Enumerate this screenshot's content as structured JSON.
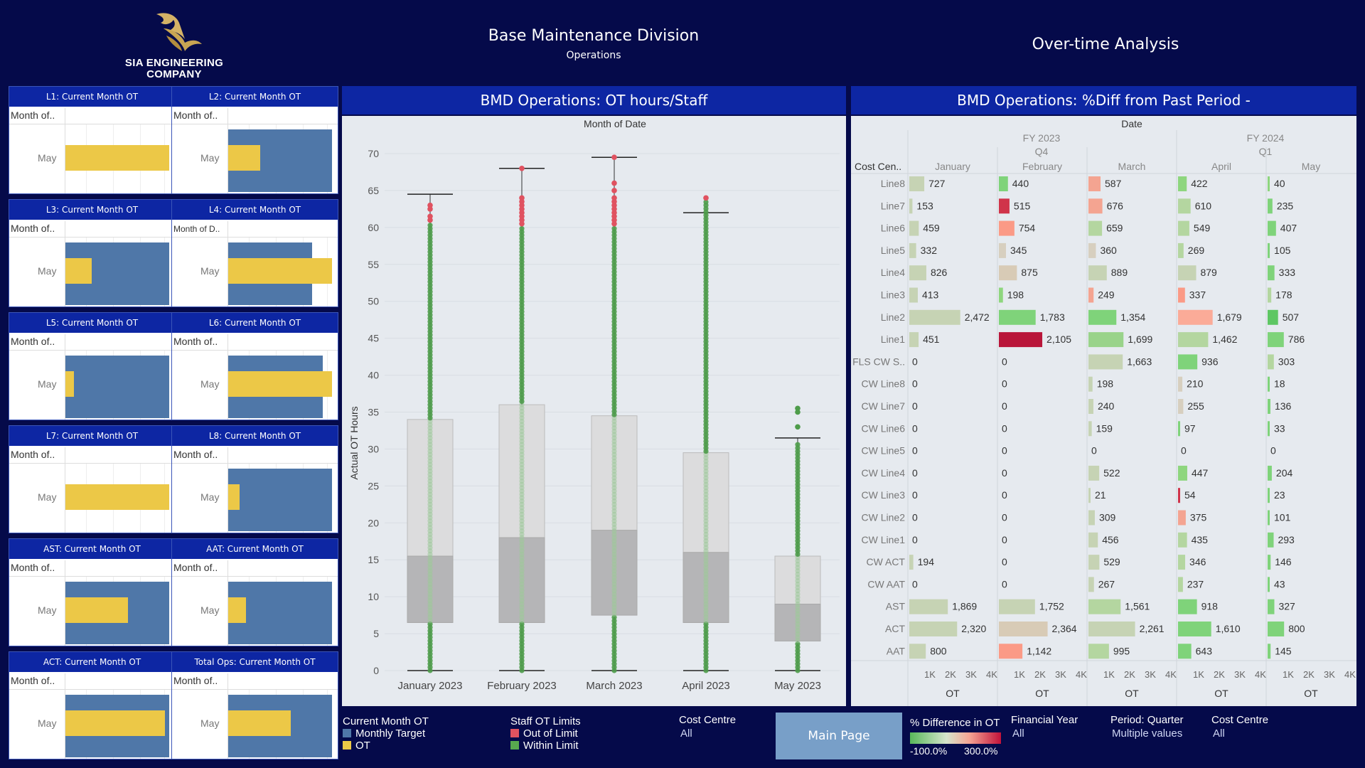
{
  "header": {
    "logo_line1": "SIA ENGINEERING",
    "logo_line2": "COMPANY",
    "title": "Base Maintenance Division",
    "subtitle": "Operations",
    "right_title": "Over-time Analysis"
  },
  "small_multiples": [
    {
      "title": "L1: Current Month OT",
      "col_header": "Month of..",
      "row": "May",
      "target": 0,
      "ot": 1.0
    },
    {
      "title": "L2: Current Month OT",
      "col_header": "Month of..",
      "row": "May",
      "target": 1.0,
      "ot": 0.31
    },
    {
      "title": "L3: Current Month OT",
      "col_header": "Month of..",
      "row": "May",
      "target": 1.0,
      "ot": 0.25
    },
    {
      "title": "L4: Current Month OT",
      "col_header": "Month of D..",
      "row": "May",
      "target": 0.81,
      "ot": 1.0
    },
    {
      "title": "L5: Current Month OT",
      "col_header": "Month of..",
      "row": "May",
      "target": 1.0,
      "ot": 0.08
    },
    {
      "title": "L6: Current Month OT",
      "col_header": "Month of..",
      "row": "May",
      "target": 0.91,
      "ot": 1.0
    },
    {
      "title": "L7: Current Month OT",
      "col_header": "Month of..",
      "row": "May",
      "target": 0,
      "ot": 1.0
    },
    {
      "title": "L8: Current Month OT",
      "col_header": "Month of..",
      "row": "May",
      "target": 1.0,
      "ot": 0.11
    },
    {
      "title": "AST: Current Month OT",
      "col_header": "Month of..",
      "row": "May",
      "target": 1.0,
      "ot": 0.6
    },
    {
      "title": "AAT: Current Month OT",
      "col_header": "Month of..",
      "row": "May",
      "target": 1.0,
      "ot": 0.17
    },
    {
      "title": "ACT: Current Month OT",
      "col_header": "Month of..",
      "row": "May",
      "target": 1.0,
      "ot": 0.96
    },
    {
      "title": "Total Ops: Current Month OT",
      "col_header": "Month of..",
      "row": "May",
      "target": 1.0,
      "ot": 0.6
    }
  ],
  "boxplot": {
    "panel_title": "BMD Operations: OT hours/Staff",
    "column_header": "Month of Date",
    "ylabel": "Actual OT Hours",
    "yticks": [
      "70",
      "65",
      "60",
      "55",
      "50",
      "45",
      "40",
      "35",
      "30",
      "25",
      "20",
      "15",
      "10",
      "5",
      "0"
    ]
  },
  "chart_data": {
    "type": "box",
    "categories": [
      "January 2023",
      "February 2023",
      "March 2023",
      "April 2023",
      "May 2023"
    ],
    "ylabel": "Actual OT Hours",
    "ylim": [
      0,
      70
    ],
    "series": [
      {
        "category": "January 2023",
        "min": 0,
        "q1": 6.5,
        "median": 15.5,
        "q3": 34,
        "whisker_high": 64.5,
        "outliers": [
          61,
          61.5,
          62.5,
          63
        ]
      },
      {
        "category": "February 2023",
        "min": 0,
        "q1": 6.5,
        "median": 18,
        "q3": 36,
        "whisker_high": 68,
        "outliers": [
          60.5,
          61,
          61.5,
          62,
          62.5,
          63,
          63.5,
          64,
          68
        ]
      },
      {
        "category": "March 2023",
        "min": 0,
        "q1": 7.5,
        "median": 19,
        "q3": 34.5,
        "whisker_high": 69.5,
        "outliers": [
          60.5,
          61,
          61.5,
          62,
          62.5,
          63,
          63.5,
          64,
          65,
          66,
          69.5
        ]
      },
      {
        "category": "April 2023",
        "min": 0,
        "q1": 6.5,
        "median": 16,
        "q3": 29.5,
        "whisker_high": 62,
        "outliers": [
          64
        ]
      },
      {
        "category": "May 2023",
        "min": 0,
        "q1": 4,
        "median": 9,
        "q3": 15.5,
        "whisker_high": 31.5,
        "outliers": [
          33,
          35,
          35.5
        ]
      }
    ]
  },
  "heat": {
    "panel_title": "BMD Operations: %Diff from Past Period -",
    "date_header": "Date",
    "row_header": "Cost Cen..",
    "fy2023": "FY 2023",
    "fy2023_q": "Q4",
    "fy2024": "FY 2024",
    "fy2024_q": "Q1",
    "months": [
      "January",
      "February",
      "March",
      "April",
      "May"
    ],
    "axis_ticks": [
      "1K",
      "2K",
      "3K",
      "4K"
    ],
    "axis_title": "OT",
    "rows": [
      {
        "name": "Line8",
        "vals": [
          727,
          440,
          587,
          422,
          40
        ],
        "labels": [
          "727",
          "440",
          "587",
          "422",
          "40"
        ],
        "colors": [
          "#c6d3b4",
          "#7fd37a",
          "#f4a491",
          "#8ed67e",
          "#8ed67e"
        ]
      },
      {
        "name": "Line7",
        "vals": [
          153,
          515,
          676,
          610,
          235
        ],
        "labels": [
          "153",
          "515",
          "676",
          "610",
          "235"
        ],
        "colors": [
          "#c6d3b4",
          "#d0344a",
          "#f4a491",
          "#b4d6a0",
          "#7fd37a"
        ]
      },
      {
        "name": "Line6",
        "vals": [
          459,
          754,
          659,
          549,
          407
        ],
        "labels": [
          "459",
          "754",
          "659",
          "549",
          "407"
        ],
        "colors": [
          "#c6d3b4",
          "#fb9a86",
          "#b4d6a0",
          "#b4d6a0",
          "#7fd37a"
        ]
      },
      {
        "name": "Line5",
        "vals": [
          332,
          345,
          360,
          269,
          105
        ],
        "labels": [
          "332",
          "345",
          "360",
          "269",
          "105"
        ],
        "colors": [
          "#c6d3b4",
          "#d7cfbf",
          "#d7cfbf",
          "#b4d6a0",
          "#7fd37a"
        ]
      },
      {
        "name": "Line4",
        "vals": [
          826,
          875,
          889,
          879,
          333
        ],
        "labels": [
          "826",
          "875",
          "889",
          "879",
          "333"
        ],
        "colors": [
          "#c6d3b4",
          "#d8cbb6",
          "#c6d3b4",
          "#c6d3b4",
          "#7fd37a"
        ]
      },
      {
        "name": "Line3",
        "vals": [
          413,
          198,
          249,
          337,
          178
        ],
        "labels": [
          "413",
          "198",
          "249",
          "337",
          "178"
        ],
        "colors": [
          "#c6d3b4",
          "#8ed67e",
          "#f4a491",
          "#fb9a86",
          "#b4d6a0"
        ]
      },
      {
        "name": "Line2",
        "vals": [
          2472,
          1783,
          1354,
          1679,
          507
        ],
        "labels": [
          "2,472",
          "1,783",
          "1,354",
          "1,679",
          "507"
        ],
        "colors": [
          "#c6d3b4",
          "#7fd37a",
          "#7fd37a",
          "#fbab98",
          "#5ec763"
        ]
      },
      {
        "name": "Line1",
        "vals": [
          451,
          2105,
          1699,
          1462,
          786
        ],
        "labels": [
          "451",
          "2,105",
          "1,699",
          "1,462",
          "786"
        ],
        "colors": [
          "#c6d3b4",
          "#b9163a",
          "#99d38a",
          "#b4d6a0",
          "#7fd37a"
        ]
      },
      {
        "name": "FLS CW S..",
        "vals": [
          0,
          0,
          1663,
          936,
          303
        ],
        "labels": [
          "0",
          "0",
          "1,663",
          "936",
          "303"
        ],
        "colors": [
          "#c6d3b4",
          "#c6d3b4",
          "#c6d3b4",
          "#7fd37a",
          "#b4d6a0"
        ]
      },
      {
        "name": "CW Line8",
        "vals": [
          0,
          0,
          198,
          210,
          18
        ],
        "labels": [
          "0",
          "0",
          "198",
          "210",
          "18"
        ],
        "colors": [
          "#c6d3b4",
          "#c6d3b4",
          "#c6d3b4",
          "#d7cfbf",
          "#7fd37a"
        ]
      },
      {
        "name": "CW Line7",
        "vals": [
          0,
          0,
          240,
          255,
          136
        ],
        "labels": [
          "0",
          "0",
          "240",
          "255",
          "136"
        ],
        "colors": [
          "#c6d3b4",
          "#c6d3b4",
          "#c6d3b4",
          "#d7cfbf",
          "#7fd37a"
        ]
      },
      {
        "name": "CW Line6",
        "vals": [
          0,
          0,
          159,
          97,
          33
        ],
        "labels": [
          "0",
          "0",
          "159",
          "97",
          "33"
        ],
        "colors": [
          "#c6d3b4",
          "#c6d3b4",
          "#c6d3b4",
          "#7fd37a",
          "#7fd37a"
        ]
      },
      {
        "name": "CW Line5",
        "vals": [
          0,
          0,
          0,
          0,
          0
        ],
        "labels": [
          "0",
          "0",
          "0",
          "0",
          "0"
        ],
        "colors": [
          "#c6d3b4",
          "#c6d3b4",
          "#c6d3b4",
          "#c6d3b4",
          "#c6d3b4"
        ]
      },
      {
        "name": "CW Line4",
        "vals": [
          0,
          0,
          522,
          447,
          204
        ],
        "labels": [
          "0",
          "0",
          "522",
          "447",
          "204"
        ],
        "colors": [
          "#c6d3b4",
          "#c6d3b4",
          "#c6d3b4",
          "#8ed67e",
          "#7fd37a"
        ]
      },
      {
        "name": "CW Line3",
        "vals": [
          0,
          0,
          21,
          54,
          23
        ],
        "labels": [
          "0",
          "0",
          "21",
          "54",
          "23"
        ],
        "colors": [
          "#c6d3b4",
          "#c6d3b4",
          "#c6d3b4",
          "#d0344a",
          "#7fd37a"
        ]
      },
      {
        "name": "CW Line2",
        "vals": [
          0,
          0,
          309,
          375,
          101
        ],
        "labels": [
          "0",
          "0",
          "309",
          "375",
          "101"
        ],
        "colors": [
          "#c6d3b4",
          "#c6d3b4",
          "#c6d3b4",
          "#f4a491",
          "#7fd37a"
        ]
      },
      {
        "name": "CW Line1",
        "vals": [
          0,
          0,
          456,
          435,
          293
        ],
        "labels": [
          "0",
          "0",
          "456",
          "435",
          "293"
        ],
        "colors": [
          "#c6d3b4",
          "#c6d3b4",
          "#c6d3b4",
          "#b4d6a0",
          "#7fd37a"
        ]
      },
      {
        "name": "CW ACT",
        "vals": [
          194,
          0,
          529,
          346,
          146
        ],
        "labels": [
          "194",
          "0",
          "529",
          "346",
          "146"
        ],
        "colors": [
          "#c6d3b4",
          "#c6d3b4",
          "#c6d3b4",
          "#b4d6a0",
          "#7fd37a"
        ]
      },
      {
        "name": "CW AAT",
        "vals": [
          0,
          0,
          267,
          237,
          43
        ],
        "labels": [
          "0",
          "0",
          "267",
          "237",
          "43"
        ],
        "colors": [
          "#c6d3b4",
          "#c6d3b4",
          "#c6d3b4",
          "#b4d6a0",
          "#7fd37a"
        ]
      },
      {
        "name": "AST",
        "vals": [
          1869,
          1752,
          1561,
          918,
          327
        ],
        "labels": [
          "1,869",
          "1,752",
          "1,561",
          "918",
          "327"
        ],
        "colors": [
          "#c6d3b4",
          "#c6d3b4",
          "#b4d6a0",
          "#7fd37a",
          "#7fd37a"
        ]
      },
      {
        "name": "ACT",
        "vals": [
          2320,
          2364,
          2261,
          1610,
          800
        ],
        "labels": [
          "2,320",
          "2,364",
          "2,261",
          "1,610",
          "800"
        ],
        "colors": [
          "#c6d3b4",
          "#d8cbb6",
          "#c6d3b4",
          "#7fd37a",
          "#7fd37a"
        ]
      },
      {
        "name": "AAT",
        "vals": [
          800,
          1142,
          995,
          643,
          145
        ],
        "labels": [
          "800",
          "1,142",
          "995",
          "643",
          "145"
        ],
        "colors": [
          "#c6d3b4",
          "#fb9a86",
          "#b4d6a0",
          "#7fd37a",
          "#7fd37a"
        ]
      }
    ]
  },
  "legend": {
    "current_month_ot": {
      "title": "Current Month OT",
      "items": [
        {
          "label": "Monthly Target",
          "color": "#4f77a8"
        },
        {
          "label": "OT",
          "color": "#ecc847"
        }
      ]
    },
    "staff_ot_limits": {
      "title": "Staff OT Limits",
      "items": [
        {
          "label": "Out of Limit",
          "color": "#e05260"
        },
        {
          "label": "Within Limit",
          "color": "#58a84f"
        }
      ]
    },
    "cost_centre_1": {
      "title": "Cost Centre",
      "value": "All"
    },
    "main_page_button": "Main Page",
    "pct_diff": {
      "title": "% Difference in OT",
      "min": "-100.0%",
      "max": "300.0%"
    },
    "financial_year": {
      "title": "Financial Year",
      "value": "All"
    },
    "period": {
      "title": "Period: Quarter",
      "value": "Multiple values"
    },
    "cost_centre_2": {
      "title": "Cost Centre",
      "value": "All"
    }
  },
  "colors": {
    "background": "#050a4a",
    "panel_header": "#0d26a3",
    "target": "#4f77a8",
    "ot": "#ecc847",
    "out_of_limit": "#e05260",
    "within_limit": "#58a84f"
  }
}
